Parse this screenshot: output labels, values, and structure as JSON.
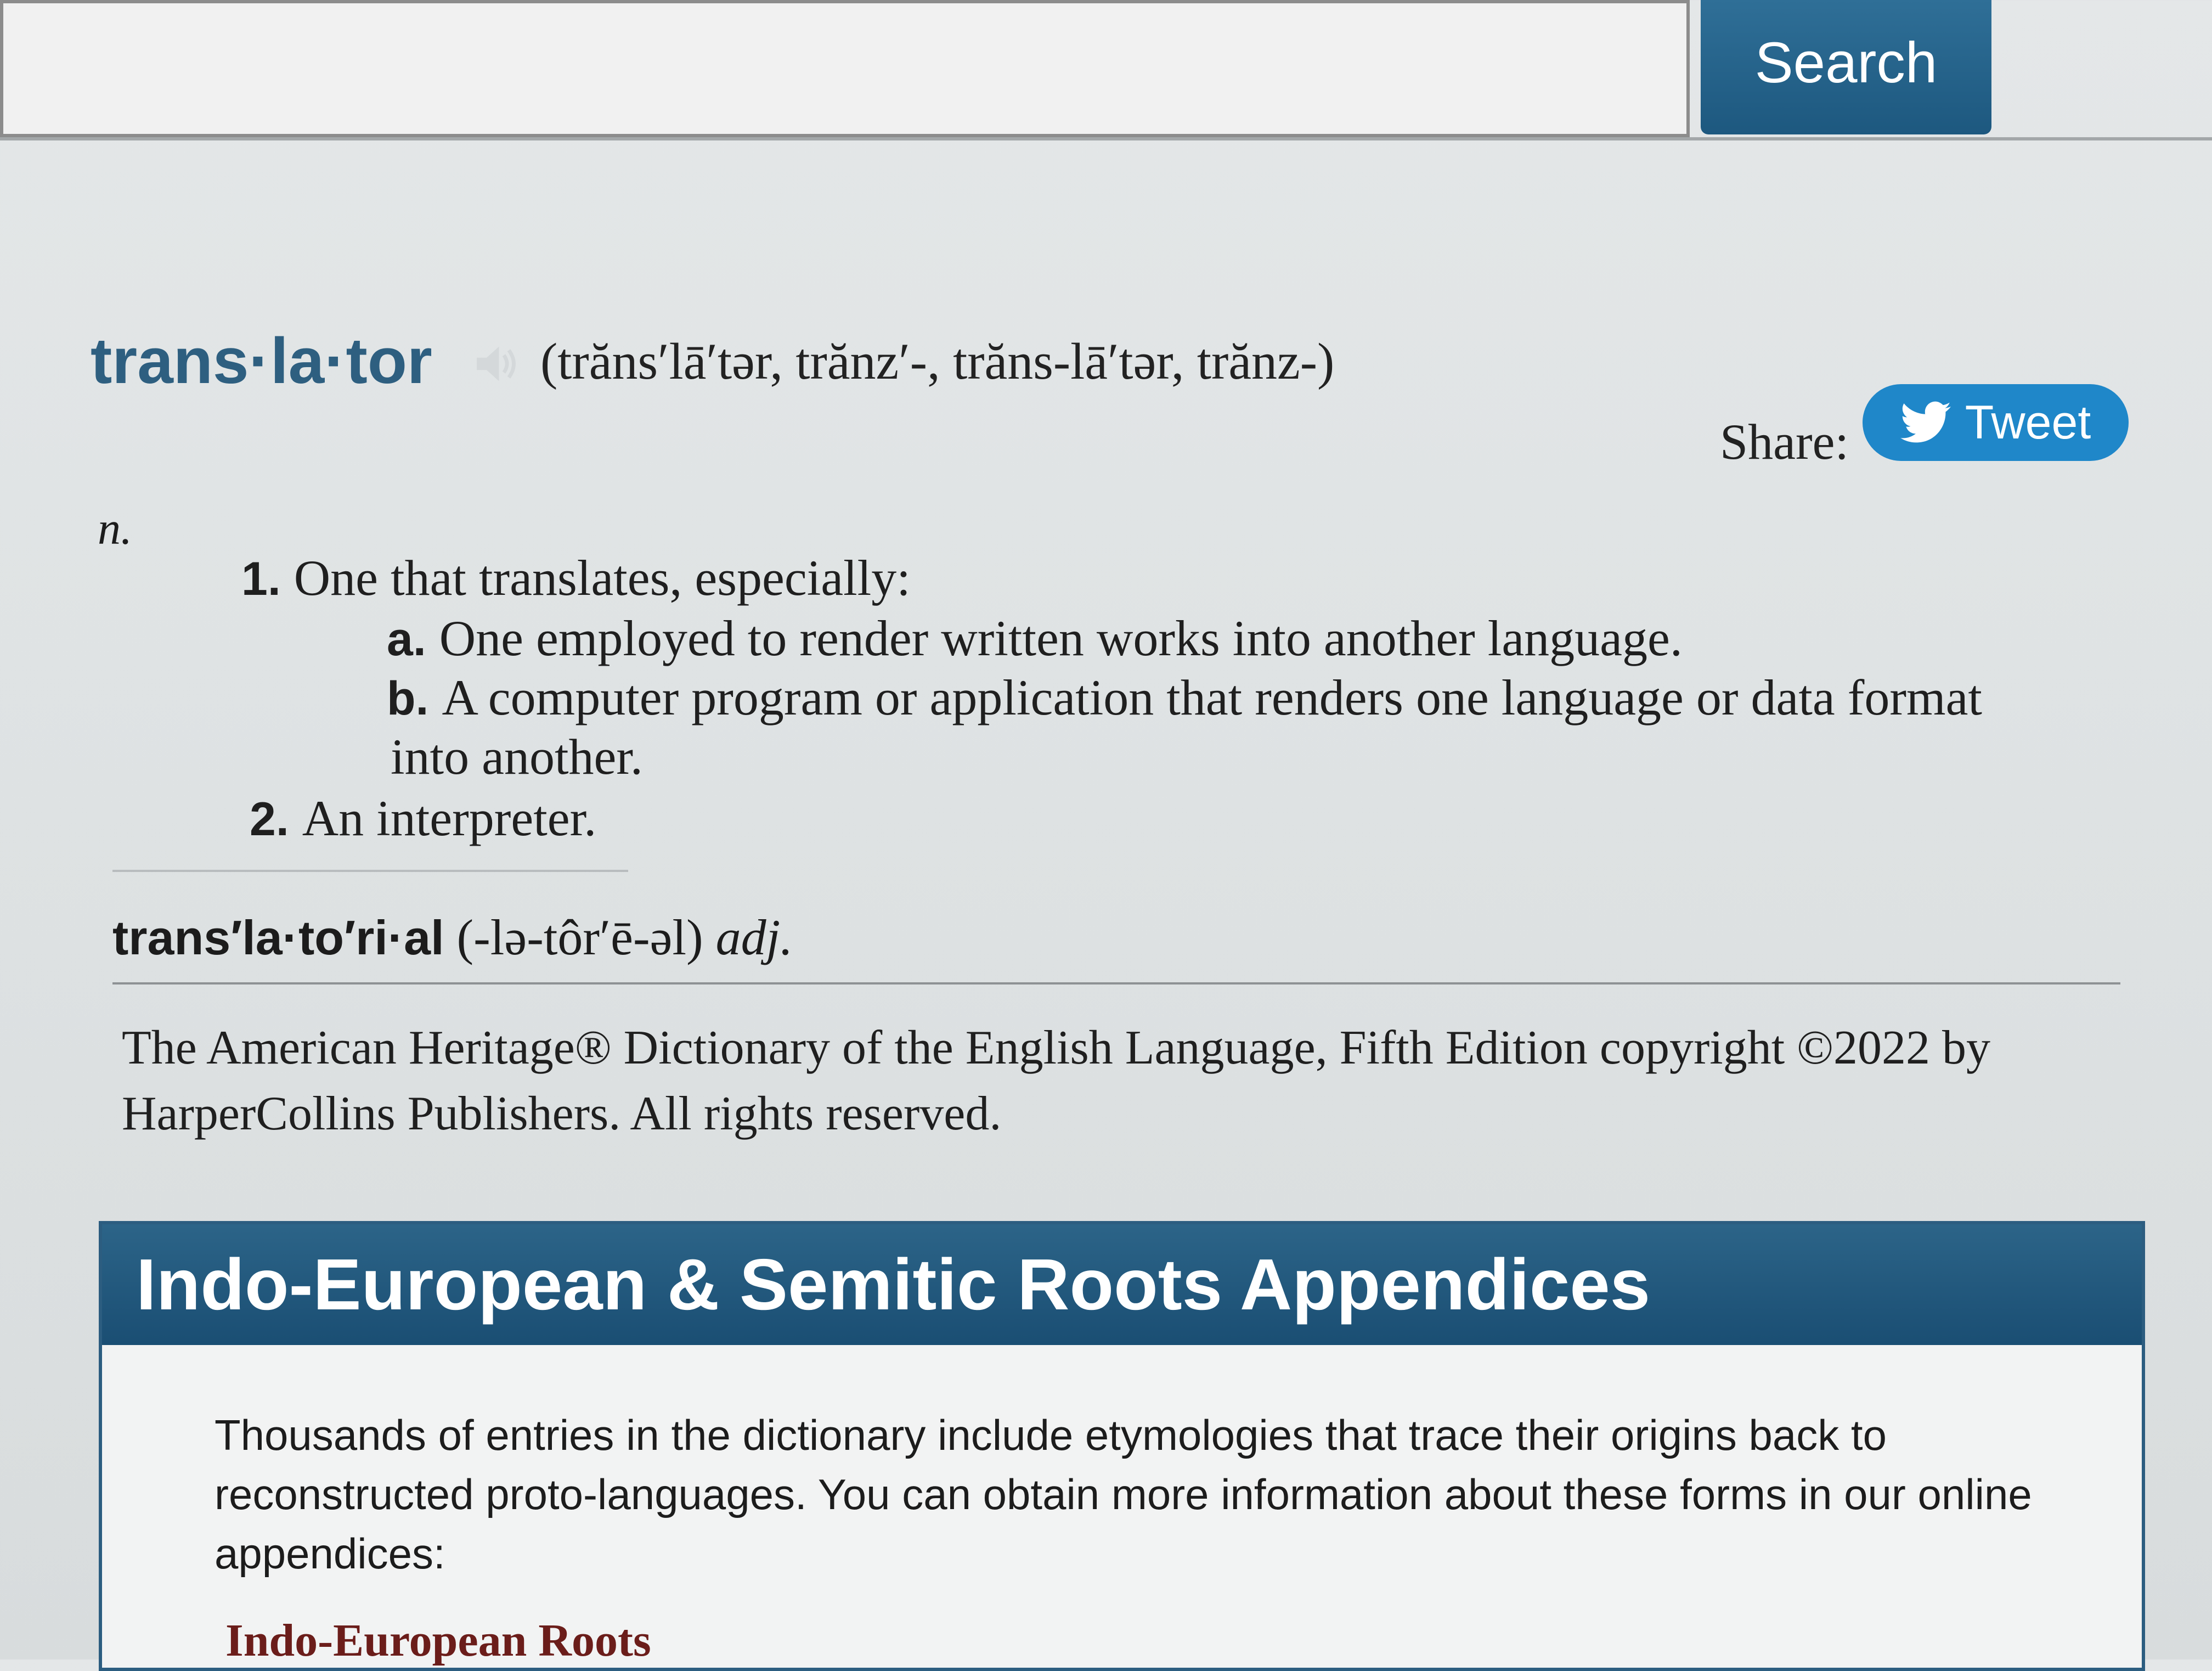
{
  "search": {
    "button_label": "Search"
  },
  "entry": {
    "headword": "trans·la·tor",
    "pronunciation": "(trăns′lā′tər, trănz′-, trăns-lā′tər, trănz-)",
    "share_label": "Share:",
    "tweet_label": "Tweet",
    "part_of_speech": "n.",
    "senses": [
      {
        "num": "1.",
        "text": "One that translates, especially:"
      },
      {
        "num": "a.",
        "text": "One employed to render written works into another language."
      },
      {
        "num": "b.",
        "text": "A computer program or application that renders one language or data format"
      },
      {
        "num": "",
        "text": "into another."
      },
      {
        "num": "2.",
        "text": "An interpreter."
      }
    ],
    "derived": {
      "word": "trans′la·to′ri·al",
      "pronunciation": "(-lə-tôr′ē-əl)",
      "pos": "adj."
    },
    "copyright": "The American Heritage® Dictionary of the English Language, Fifth Edition copyright ©2022 by HarperCollins Publishers. All rights reserved."
  },
  "roots": {
    "title": "Indo-European & Semitic Roots Appendices",
    "body": "Thousands of entries in the dictionary include etymologies that trace their origins back to reconstructed proto-languages. You can obtain more information about these forms in our online appendices:",
    "link": "Indo-European Roots"
  },
  "colors": {
    "accent": "#1d587f",
    "headword": "#2e5f80",
    "tweet": "#1f87c9",
    "link": "#6b1d1a"
  },
  "icons": [
    "speaker-icon",
    "twitter-bird-icon"
  ]
}
